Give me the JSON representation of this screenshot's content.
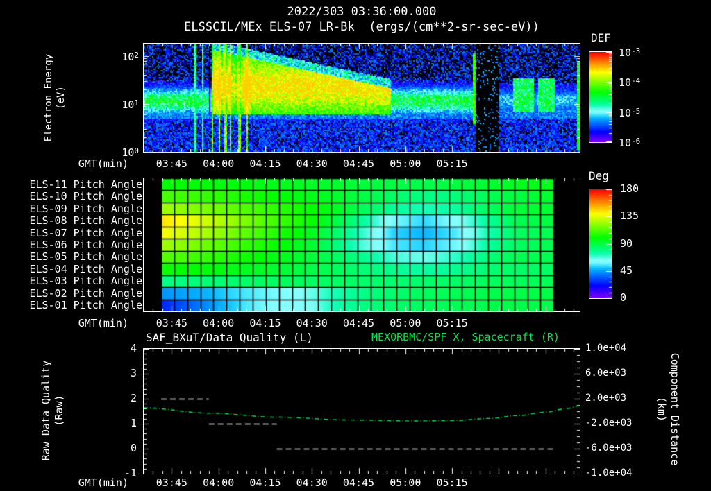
{
  "header": {
    "datetime": "2022/303 03:36:00.000",
    "instrument": "ELSSCIL/MEx ELS-07 LR-Bk",
    "units": "(ergs/(cm**2-sr-sec-eV))"
  },
  "colors": {
    "background": "#000000",
    "foreground": "#ffffff",
    "accent_green": "#00e64d"
  },
  "time_axis": {
    "label": "GMT(min)",
    "start_minute": 0,
    "end_minute": 140,
    "minor_step_minutes": 3,
    "major_tick_minutes": [
      9,
      24,
      39,
      54,
      69,
      84,
      99,
      114,
      129
    ],
    "tick_labels": [
      {
        "minute": 9,
        "text": "03:45"
      },
      {
        "minute": 24,
        "text": "04:00"
      },
      {
        "minute": 39,
        "text": "04:15"
      },
      {
        "minute": 54,
        "text": "04:30"
      },
      {
        "minute": 69,
        "text": "04:45"
      },
      {
        "minute": 84,
        "text": "05:00"
      },
      {
        "minute": 99,
        "text": "05:15"
      }
    ]
  },
  "spectrogram": {
    "y_label_lines": [
      "Electron Energy",
      "(eV)"
    ],
    "y_ticks": [
      {
        "base": "10",
        "exp": "2"
      },
      {
        "base": "10",
        "exp": "1"
      },
      {
        "base": "10",
        "exp": "0"
      }
    ],
    "colorbar": {
      "title": "DEF",
      "ticks": [
        {
          "base": "10",
          "exp": "-3"
        },
        {
          "base": "10",
          "exp": "-4"
        },
        {
          "base": "10",
          "exp": "-5"
        },
        {
          "base": "10",
          "exp": "-6"
        }
      ]
    }
  },
  "pitch_panel": {
    "row_labels": [
      "ELS-11 Pitch Angle",
      "ELS-10 Pitch Angle",
      "ELS-09 Pitch Angle",
      "ELS-08 Pitch Angle",
      "ELS-07 Pitch Angle",
      "ELS-06 Pitch Angle",
      "ELS-05 Pitch Angle",
      "ELS-04 Pitch Angle",
      "ELS-03 Pitch Angle",
      "ELS-02 Pitch Angle",
      "ELS-01 Pitch Angle"
    ],
    "colorbar": {
      "title": "Deg",
      "ticks": [
        "180",
        "135",
        "90",
        "45",
        "0"
      ]
    }
  },
  "bottom_panel": {
    "left_title": "SAF_BXuT/Data Quality (L)",
    "right_title": "MEXORBMC/SPF X, Spacecraft (R)",
    "left_axis_label_lines": [
      "Raw Data Quality",
      "(Raw)"
    ],
    "right_axis_label_lines": [
      "Component Distance",
      "(km)"
    ],
    "left_ticks": [
      "4",
      "3",
      "2",
      "1",
      "0",
      "-1"
    ],
    "right_ticks": [
      "1.0e+04",
      "6.0e+03",
      "2.0e+03",
      "-2.0e+03",
      "-6.0e+03",
      "-1.0e+04"
    ]
  },
  "chart_data": [
    {
      "type": "heatmap",
      "title": "ELSSCIL/MEx ELS-07 LR-Bk",
      "subtitle": "2022/303 03:36:00.000",
      "xlabel": "GMT(min)",
      "ylabel": "Electron Energy (eV)",
      "x_range_minutes": [
        0,
        140
      ],
      "y_range_ev": [
        1,
        180
      ],
      "y_scale": "log",
      "value_units": "ergs/(cm**2-sr-sec-eV)",
      "value_range": [
        1e-06,
        0.001
      ],
      "features": {
        "quiet_band_logE_center": 1.08,
        "quiet_band_logE_width": 0.2,
        "burst_t": [
          21.5,
          79
        ],
        "burst_top_logE": [
          2.15,
          1.35
        ],
        "burst_bright_until_t": 33,
        "pre_burst_streak_ts": [
          16.3,
          18.7
        ],
        "dark_column_t": [
          20.6,
          21.4
        ],
        "data_gap_t": [
          106.4,
          114
        ],
        "green_streak_t": 105.9,
        "right_edge_streak_t": 138.9,
        "post_gap_patches_t": [
          [
            118.5,
            125
          ],
          [
            126.5,
            131.8
          ]
        ]
      }
    },
    {
      "type": "heatmap",
      "title": "ELS Pitch Angles",
      "value_units": "Deg",
      "value_range_deg": [
        0,
        180
      ],
      "t_range_minutes": [
        5.6,
        131.6
      ],
      "columns": 30,
      "rows": [
        {
          "name": "ELS-11",
          "keyframes": [
            [
              6,
              102
            ],
            [
              30,
              100
            ],
            [
              55,
              96
            ],
            [
              75,
              92
            ],
            [
              90,
              90
            ],
            [
              105,
              93
            ],
            [
              120,
              97
            ],
            [
              131,
              99
            ]
          ]
        },
        {
          "name": "ELS-10",
          "keyframes": [
            [
              6,
              113
            ],
            [
              25,
              108
            ],
            [
              45,
              101
            ],
            [
              60,
              96
            ],
            [
              75,
              89
            ],
            [
              85,
              83
            ],
            [
              95,
              81
            ],
            [
              105,
              85
            ],
            [
              115,
              91
            ],
            [
              131,
              95
            ]
          ]
        },
        {
          "name": "ELS-09",
          "keyframes": [
            [
              6,
              124
            ],
            [
              25,
              116
            ],
            [
              45,
              105
            ],
            [
              60,
              96
            ],
            [
              70,
              86
            ],
            [
              80,
              76
            ],
            [
              90,
              72
            ],
            [
              100,
              75
            ],
            [
              110,
              84
            ],
            [
              120,
              91
            ],
            [
              131,
              92
            ]
          ]
        },
        {
          "name": "ELS-08",
          "keyframes": [
            [
              6,
              144
            ],
            [
              15,
              137
            ],
            [
              25,
              127
            ],
            [
              40,
              112
            ],
            [
              55,
              100
            ],
            [
              70,
              77
            ],
            [
              80,
              59
            ],
            [
              90,
              53
            ],
            [
              100,
              61
            ],
            [
              110,
              76
            ],
            [
              120,
              88
            ],
            [
              131,
              90
            ]
          ]
        },
        {
          "name": "ELS-07",
          "keyframes": [
            [
              6,
              139
            ],
            [
              15,
              131
            ],
            [
              25,
              122
            ],
            [
              40,
              108
            ],
            [
              55,
              95
            ],
            [
              70,
              71
            ],
            [
              80,
              53
            ],
            [
              90,
              49
            ],
            [
              100,
              56
            ],
            [
              110,
              73
            ],
            [
              120,
              86
            ],
            [
              131,
              88
            ]
          ]
        },
        {
          "name": "ELS-06",
          "keyframes": [
            [
              6,
              126
            ],
            [
              15,
              121
            ],
            [
              25,
              114
            ],
            [
              40,
              104
            ],
            [
              55,
              92
            ],
            [
              70,
              69
            ],
            [
              80,
              56
            ],
            [
              90,
              53
            ],
            [
              100,
              59
            ],
            [
              110,
              76
            ],
            [
              120,
              86
            ],
            [
              131,
              88
            ]
          ]
        },
        {
          "name": "ELS-05",
          "keyframes": [
            [
              6,
              114
            ],
            [
              20,
              109
            ],
            [
              40,
              99
            ],
            [
              55,
              91
            ],
            [
              70,
              79
            ],
            [
              80,
              69
            ],
            [
              90,
              66
            ],
            [
              100,
              71
            ],
            [
              110,
              81
            ],
            [
              120,
              88
            ],
            [
              131,
              88
            ]
          ]
        },
        {
          "name": "ELS-04",
          "keyframes": [
            [
              6,
              103
            ],
            [
              25,
              99
            ],
            [
              45,
              93
            ],
            [
              60,
              88
            ],
            [
              75,
              81
            ],
            [
              85,
              77
            ],
            [
              95,
              77
            ],
            [
              105,
              81
            ],
            [
              115,
              85
            ],
            [
              131,
              86
            ]
          ]
        },
        {
          "name": "ELS-03",
          "keyframes": [
            [
              6,
              80
            ],
            [
              25,
              83
            ],
            [
              45,
              86
            ],
            [
              65,
              85
            ],
            [
              80,
              83
            ],
            [
              95,
              84
            ],
            [
              110,
              86
            ],
            [
              131,
              87
            ]
          ]
        },
        {
          "name": "ELS-02",
          "keyframes": [
            [
              6,
              44
            ],
            [
              20,
              48
            ],
            [
              30,
              54
            ],
            [
              40,
              58
            ],
            [
              50,
              62
            ],
            [
              60,
              72
            ],
            [
              72,
              80
            ],
            [
              85,
              85
            ],
            [
              100,
              87
            ],
            [
              115,
              89
            ],
            [
              131,
              89
            ]
          ]
        },
        {
          "name": "ELS-01",
          "keyframes": [
            [
              6,
              28
            ],
            [
              14,
              36
            ],
            [
              22,
              46
            ],
            [
              32,
              56
            ],
            [
              42,
              62
            ],
            [
              52,
              63
            ],
            [
              62,
              75
            ],
            [
              72,
              82
            ],
            [
              85,
              86
            ],
            [
              100,
              88
            ],
            [
              115,
              90
            ],
            [
              131,
              90
            ]
          ]
        }
      ]
    },
    {
      "type": "line",
      "left_axis": {
        "label": "Raw Data Quality (Raw)",
        "range": [
          -1,
          4
        ]
      },
      "right_axis": {
        "label": "Component Distance (km)",
        "range": [
          -10000,
          10000
        ]
      },
      "series": [
        {
          "name": "SAF_BXuT/Data Quality",
          "axis": "left",
          "color": "#ffffff",
          "style": "dashed",
          "segments": [
            {
              "value": 2,
              "t_start": 5.6,
              "t_end": 20.9
            },
            {
              "value": 1,
              "t_start": 20.9,
              "t_end": 42.7
            },
            {
              "value": 0,
              "t_start": 42.7,
              "t_end": 131.6
            }
          ]
        },
        {
          "name": "MEXORBMC/SPF X, Spacecraft",
          "axis": "right",
          "color": "#00e64d",
          "style": "dash-dot",
          "points_t_km": [
            [
              0,
              550
            ],
            [
              21,
              -300
            ],
            [
              43,
              -950
            ],
            [
              66,
              -1400
            ],
            [
              88,
              -1550
            ],
            [
              100,
              -1480
            ],
            [
              111,
              -1150
            ],
            [
              120,
              -700
            ],
            [
              129,
              -150
            ],
            [
              136,
              450
            ],
            [
              140,
              900
            ]
          ]
        }
      ]
    }
  ]
}
